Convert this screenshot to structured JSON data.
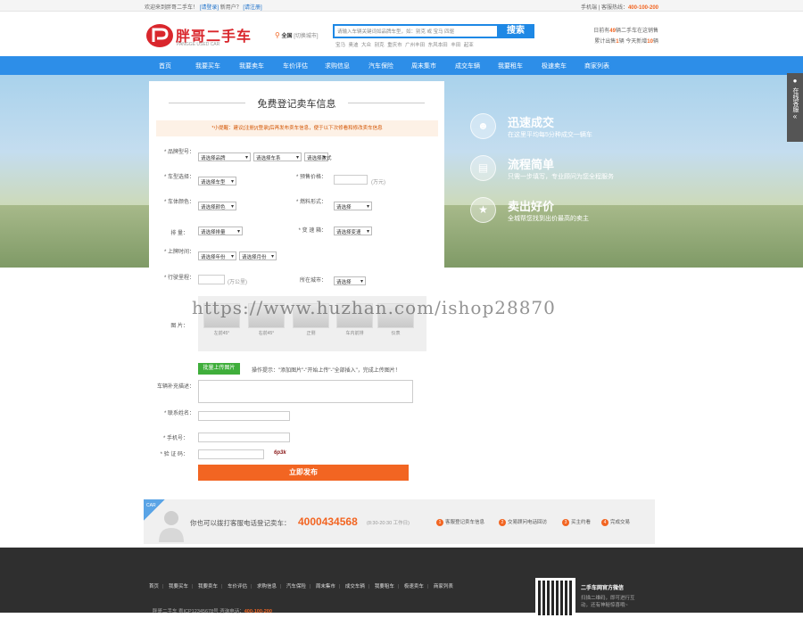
{
  "topbar": {
    "welcome": "欢迎来到胖哥二手车！",
    "login": "[请登录]",
    "new_user": "新用户？",
    "register": "[请注册]",
    "mobile": "手机端",
    "service_label": "客服热线：",
    "service_phone": "400-100-200"
  },
  "logo": {
    "name": "胖哥二手车",
    "sub": "PANGGE USED CAR"
  },
  "city": {
    "current": "全国",
    "switch": "[切换城市]"
  },
  "search": {
    "placeholder": "请输入车辆关键词如品牌车型，如：别克 或 宝马 四驱",
    "button": "搜索",
    "hot": "宝马  奥迪  大众  别克  重庆市  广州丰田  东风本田  丰田  起亚"
  },
  "stats": {
    "line1_a": "日前有",
    "line1_num": "49",
    "line1_b": "辆二手车在这销售",
    "line2_a": "累计出售",
    "line2_num1": "1",
    "line2_b": "辆 今天新增",
    "line2_num2": "10",
    "line2_c": "辆"
  },
  "nav": [
    "首页",
    "我要买车",
    "我要卖车",
    "车价评估",
    "求购信息",
    "汽车保险",
    "周末集市",
    "成交车辆",
    "我要租车",
    "极速卖车",
    "商家列表"
  ],
  "features": [
    {
      "icon": "people-icon",
      "title": "迅速成交",
      "desc": "在这里平均每5分种成交一辆车"
    },
    {
      "icon": "clipboard-icon",
      "title": "流程简单",
      "desc": "只需一步填写，专业顾问为您全程服务"
    },
    {
      "icon": "trophy-icon",
      "title": "卖出好价",
      "desc": "全城帮您找到出价最高的卖主"
    }
  ],
  "side_service": "在线客服",
  "form": {
    "title": "免费登记卖车信息",
    "tip": "*小提醒：建议[注册]/[登录]后再发布卖车信息，便于以下次修看和修改卖车信息",
    "labels": {
      "brand": "* 品牌型号：",
      "body": "* 车型选择：",
      "price": "* 预售价格：",
      "color": "* 车体颜色：",
      "fuel": "* 燃料形式：",
      "displacement": "排  量：",
      "gearbox": "* 变 速 箱：",
      "reg": "* 上牌时间：",
      "mileage": "* 行驶里程：",
      "city": "所在城市：",
      "photos": "图  片：",
      "notes": "车辆补充描述：",
      "contact": "* 联系姓名：",
      "phone": "* 手机号：",
      "code": "* 验 证 码："
    },
    "selects": {
      "brand": "请选择品牌",
      "series": "请选择车系",
      "model": "请选择款式",
      "body": "请选择车型",
      "color": "请选择颜色",
      "fuel": "请选择",
      "displacement": "请选择排量",
      "gearbox": "请选择变速",
      "year": "请选择年份",
      "month": "请选择月份",
      "city": "请选择"
    },
    "units": {
      "price": "(万元)",
      "mileage": "(万公里)"
    },
    "photos": [
      "左前45°",
      "右前45°",
      "正侧",
      "车内前排",
      "仪表"
    ],
    "upload_button": "批量上传图片",
    "upload_tip": "操作提示：\"添加图片\"-\"开始上传\"-\"全部插入\"，完成上传图片！",
    "captcha": "6p3k",
    "submit": "立即发布"
  },
  "hotline": {
    "tag": "CAR",
    "text": "你也可以拨打客服电话登记卖车：",
    "number": "4000434568",
    "hours": "(8:30-20:30 工作日)",
    "steps": [
      "客服登记卖车信息",
      "交易顾问电话回访",
      "买主约看",
      "完成交易"
    ]
  },
  "footer": {
    "links": [
      "首页",
      "我要买车",
      "我要卖车",
      "车价评估",
      "求购信息",
      "汽车保险",
      "周末集市",
      "成交车辆",
      "我要租车",
      "极速卖车",
      "商家列表"
    ],
    "copyright": "胖哥二手车   粤ICP12345678号   咨询电话：",
    "phone": "400-100-200",
    "qr_title": "二手车网官方微信",
    "qr_desc": "扫描二维码，即可进行互动，还有神秘惊喜哦~"
  },
  "watermark": "https://www.huzhan.com/ishop28870"
}
